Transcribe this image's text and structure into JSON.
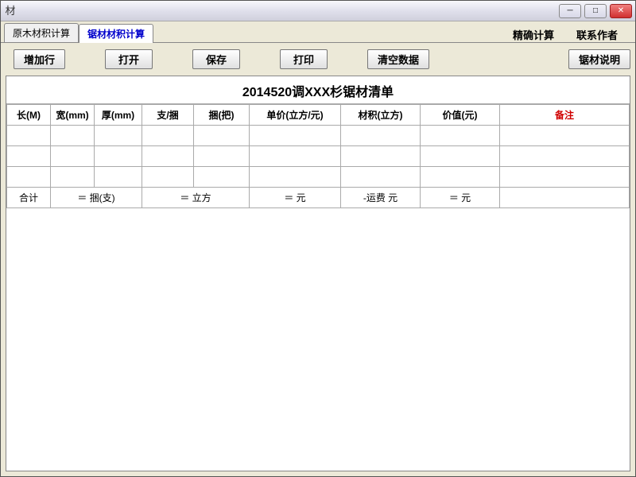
{
  "titlebar": {
    "icon_char": "材",
    "title": ""
  },
  "window_controls": {
    "minimize": "─",
    "maximize": "□",
    "close": "✕"
  },
  "tabs": {
    "items": [
      {
        "label": "原木材积计算"
      },
      {
        "label": "锯材材积计算"
      }
    ],
    "right_links": [
      {
        "label": "精确计算"
      },
      {
        "label": "联系作者"
      }
    ]
  },
  "toolbar": {
    "add_row": "增加行",
    "open": "打开",
    "save": "保存",
    "print": "打印",
    "clear": "清空数据",
    "desc": "锯材说明"
  },
  "table": {
    "title": "2014520调XXX杉锯材清单",
    "headers": [
      "长(M)",
      "宽(mm)",
      "厚(mm)",
      "支/捆",
      "捆(把)",
      "单价(立方/元)",
      "材积(立方)",
      "价值(元)",
      "备注"
    ],
    "rows": [
      [
        "",
        "",
        "",
        "",
        "",
        "",
        "",
        "",
        ""
      ],
      [
        "",
        "",
        "",
        "",
        "",
        "",
        "",
        "",
        ""
      ],
      [
        "",
        "",
        "",
        "",
        "",
        "",
        "",
        "",
        ""
      ]
    ],
    "footer": {
      "label": "合计",
      "bundle": "＝ 捆(支)",
      "volume": "＝ 立方",
      "yuan": "＝ 元",
      "freight": "-运费  元",
      "total_yuan": "＝ 元"
    }
  }
}
